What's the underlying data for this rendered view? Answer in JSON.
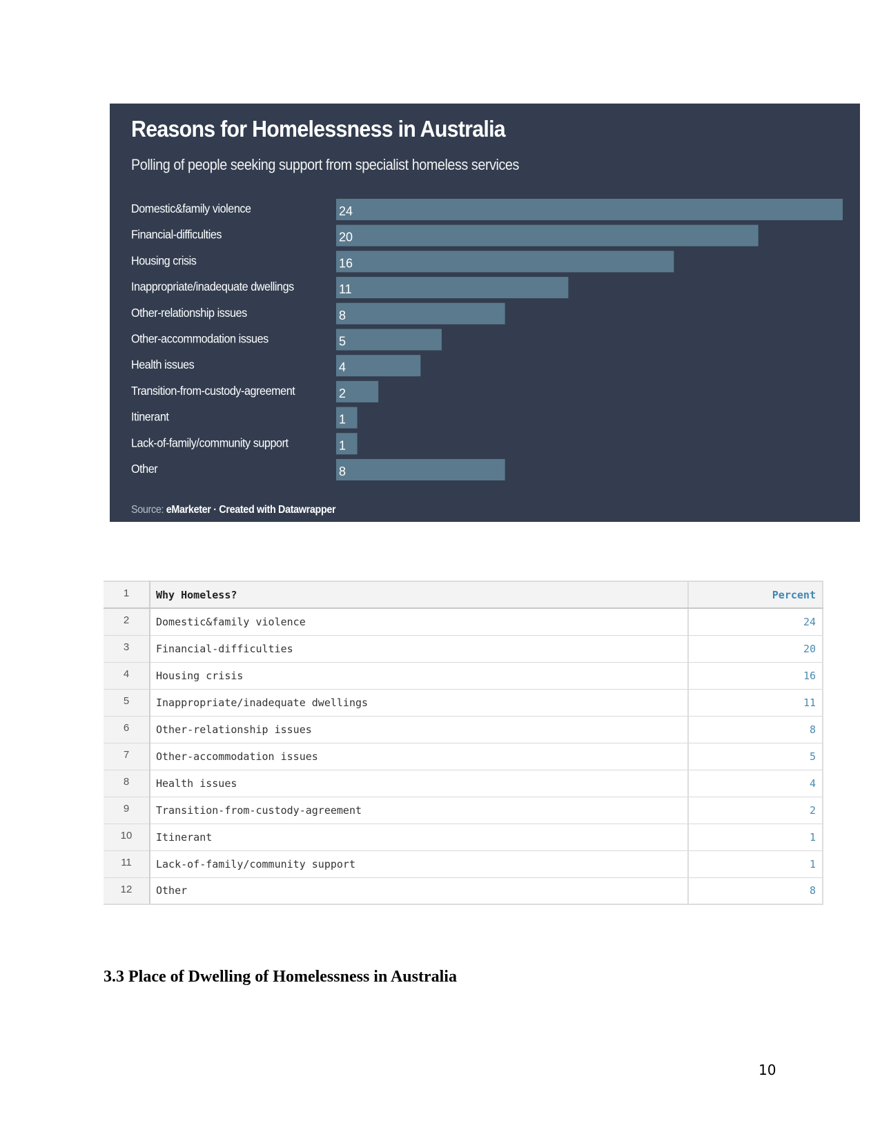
{
  "chart_data": {
    "type": "bar",
    "orientation": "horizontal",
    "title": "Reasons for Homelessness in Australia",
    "subtitle": "Polling of people seeking support from specialist homeless services",
    "categories": [
      "Domestic&family violence",
      "Financial-difficulties",
      "Housing crisis",
      "Inappropriate/inadequate dwellings",
      "Other-relationship issues",
      "Other-accommodation issues",
      "Health issues",
      "Transition-from-custody-agreement",
      "Itinerant",
      "Lack-of-family/community support",
      "Other"
    ],
    "values": [
      24,
      20,
      16,
      11,
      8,
      5,
      4,
      2,
      1,
      1,
      8
    ],
    "xlabel": "",
    "ylabel": "",
    "xlim": [
      0,
      24
    ],
    "grid": false,
    "data_labels": true,
    "colors": {
      "background": "#333d4f",
      "bar": "#5b7a8e",
      "text": "#ffffff"
    },
    "source_prefix": "Source:",
    "source_name": "eMarketer",
    "source_separator": "·",
    "credit": "Created with Datawrapper"
  },
  "table": {
    "header": {
      "row_number": "1",
      "label": "Why Homeless?",
      "value": "Percent"
    },
    "rows": [
      {
        "row_number": "2",
        "label": "Domestic&family violence",
        "value": "24"
      },
      {
        "row_number": "3",
        "label": "Financial-difficulties",
        "value": "20"
      },
      {
        "row_number": "4",
        "label": "Housing crisis",
        "value": "16"
      },
      {
        "row_number": "5",
        "label": "Inappropriate/inadequate dwellings",
        "value": "11"
      },
      {
        "row_number": "6",
        "label": "Other-relationship issues",
        "value": "8"
      },
      {
        "row_number": "7",
        "label": "Other-accommodation issues",
        "value": "5"
      },
      {
        "row_number": "8",
        "label": "Health issues",
        "value": "4"
      },
      {
        "row_number": "9",
        "label": "Transition-from-custody-agreement",
        "value": "2"
      },
      {
        "row_number": "10",
        "label": "Itinerant",
        "value": "1"
      },
      {
        "row_number": "11",
        "label": "Lack-of-family/community support",
        "value": "1"
      },
      {
        "row_number": "12",
        "label": "Other",
        "value": "8"
      }
    ]
  },
  "document": {
    "section_heading": "3.3 Place of Dwelling of Homelessness in Australia",
    "page_number": "10"
  }
}
